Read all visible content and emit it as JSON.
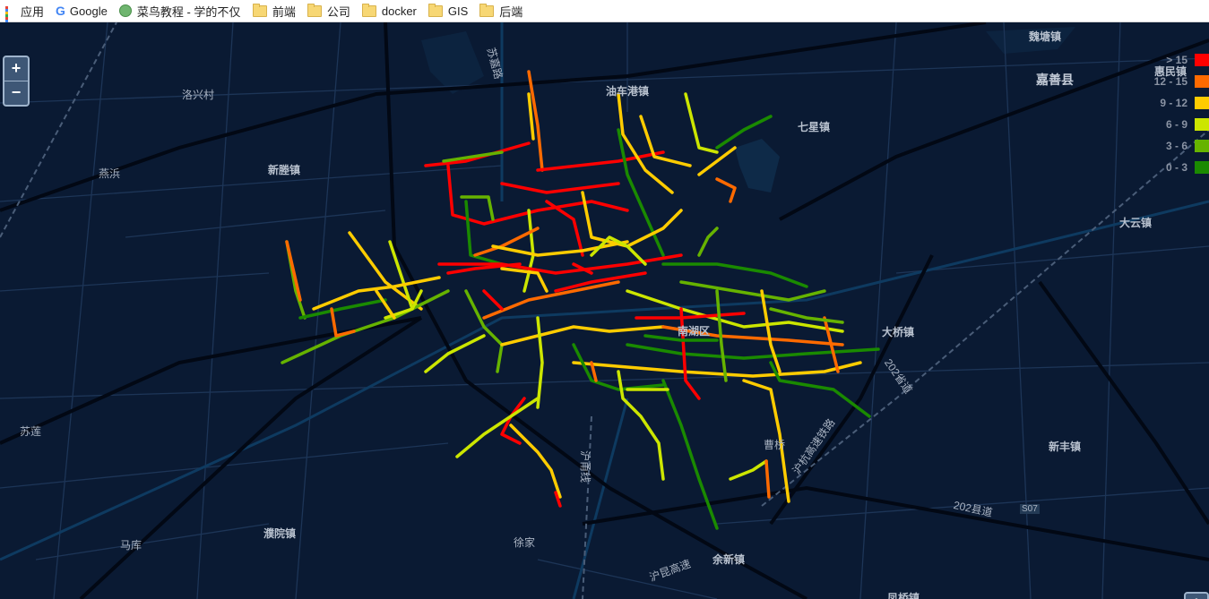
{
  "bookmarks": {
    "items": [
      {
        "label": "应用",
        "icon": "apps-grid-icon"
      },
      {
        "label": "Google",
        "icon": "google-icon"
      },
      {
        "label": "菜鸟教程 - 学的不仅是",
        "icon": "runoob-icon"
      },
      {
        "label": "前端",
        "icon": "folder-icon"
      },
      {
        "label": "公司",
        "icon": "folder-icon"
      },
      {
        "label": "docker",
        "icon": "folder-icon"
      },
      {
        "label": "GIS",
        "icon": "folder-icon"
      },
      {
        "label": "后端",
        "icon": "folder-icon"
      }
    ]
  },
  "map": {
    "zoom_in_label": "+",
    "zoom_out_label": "−",
    "info_label": "i",
    "places": [
      {
        "text": "魏塘镇",
        "style": "b"
      },
      {
        "text": "嘉善县",
        "style": "big"
      },
      {
        "text": "惠民镇",
        "style": "b"
      },
      {
        "text": "七星镇",
        "style": "b"
      },
      {
        "text": "大云镇",
        "style": "b"
      },
      {
        "text": "油车港镇",
        "style": "b"
      },
      {
        "text": "洛兴村",
        "style": "n"
      },
      {
        "text": "新塍镇",
        "style": "b"
      },
      {
        "text": "燕浜",
        "style": "n"
      },
      {
        "text": "苏嘉路",
        "style": "n"
      },
      {
        "text": "南湖区",
        "style": "b"
      },
      {
        "text": "大桥镇",
        "style": "b"
      },
      {
        "text": "新丰镇",
        "style": "b"
      },
      {
        "text": "202省道",
        "style": "n"
      },
      {
        "text": "202县道",
        "style": "n"
      },
      {
        "text": "S07",
        "style": "n"
      },
      {
        "text": "苏莲",
        "style": "n"
      },
      {
        "text": "马库",
        "style": "n"
      },
      {
        "text": "濮院镇",
        "style": "b"
      },
      {
        "text": "徐家",
        "style": "n"
      },
      {
        "text": "余新镇",
        "style": "b"
      },
      {
        "text": "曹桥",
        "style": "n"
      },
      {
        "text": "沪杭高速铁路",
        "style": "n"
      },
      {
        "text": "沪昆高速",
        "style": "n"
      },
      {
        "text": "沪甬线",
        "style": "n"
      },
      {
        "text": "凤桥镇",
        "style": "b"
      }
    ]
  },
  "legend": {
    "items": [
      {
        "label": "> 15",
        "color": "#ff0000"
      },
      {
        "label": "12 - 15",
        "color": "#ff6a00"
      },
      {
        "label": "9 - 12",
        "color": "#ffcc00"
      },
      {
        "label": "6 - 9",
        "color": "#cce600"
      },
      {
        "label": "3 - 6",
        "color": "#66b300"
      },
      {
        "label": "0 - 3",
        "color": "#1a8a00"
      }
    ]
  }
}
